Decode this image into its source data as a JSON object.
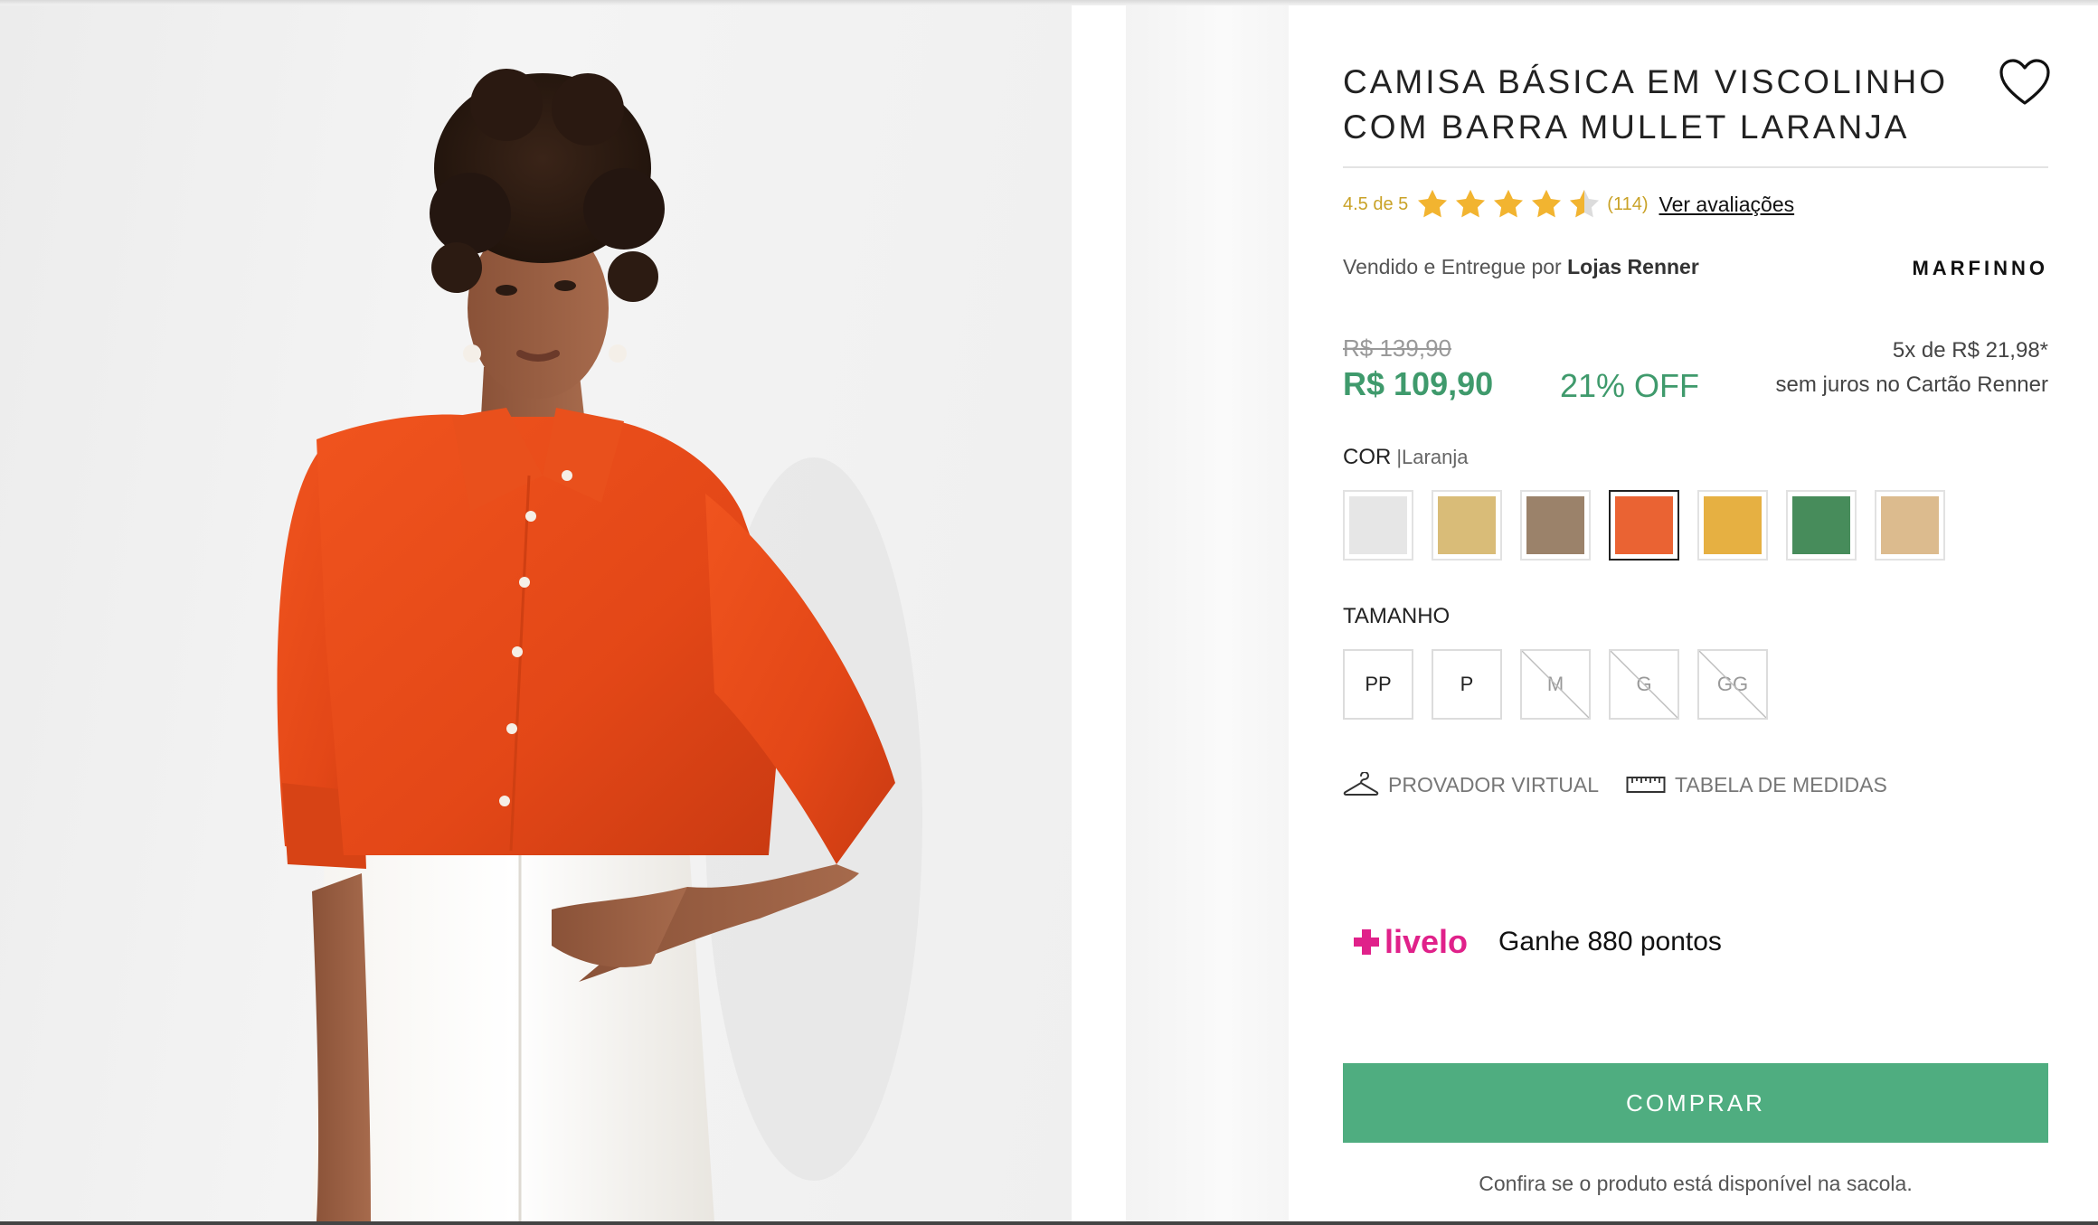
{
  "product": {
    "title": "CAMISA BÁSICA EM VISCOLINHO\nCOM BARRA MULLET LARANJA",
    "rating_text": "4.5 de 5",
    "rating_value": 4.5,
    "rating_max": 5,
    "review_count": "(114)",
    "reviews_link": "Ver avaliações",
    "seller_prefix": "Vendido e Entregue por",
    "seller_name": "Lojas Renner",
    "brand": "MARFINNO"
  },
  "pricing": {
    "old_price": "R$ 139,90",
    "price": "R$ 109,90",
    "discount": "21% OFF",
    "installments": "5x de R$ 21,98*",
    "installments_note": "sem juros no Cartão Renner"
  },
  "color": {
    "label": "COR",
    "selected_label": "|Laranja",
    "swatches": [
      {
        "color": "#e6e6e6"
      },
      {
        "color": "#d9bc78"
      },
      {
        "color": "#9b826a"
      },
      {
        "color": "#ea6333",
        "selected": true
      },
      {
        "color": "#e6b042"
      },
      {
        "color": "#478c5b"
      },
      {
        "color": "#dcbb8e"
      }
    ]
  },
  "size": {
    "label": "TAMANHO",
    "options": [
      {
        "label": "PP",
        "available": true
      },
      {
        "label": "P",
        "available": true
      },
      {
        "label": "M",
        "available": false
      },
      {
        "label": "G",
        "available": false
      },
      {
        "label": "GG",
        "available": false
      }
    ]
  },
  "tools": {
    "virtual_fitting": "PROVADOR VIRTUAL",
    "size_chart": "TABELA DE MEDIDAS"
  },
  "loyalty": {
    "logo_text": "livelo",
    "points": "Ganhe 880 pontos"
  },
  "actions": {
    "buy": "COMPRAR",
    "availability_note": "Confira se o produto está disponível na sacola."
  },
  "colors": {
    "accent_green": "#4fad80",
    "price_green": "#3f9a6c",
    "rating_gold": "#f2b430",
    "livelo_pink": "#e0218a"
  }
}
